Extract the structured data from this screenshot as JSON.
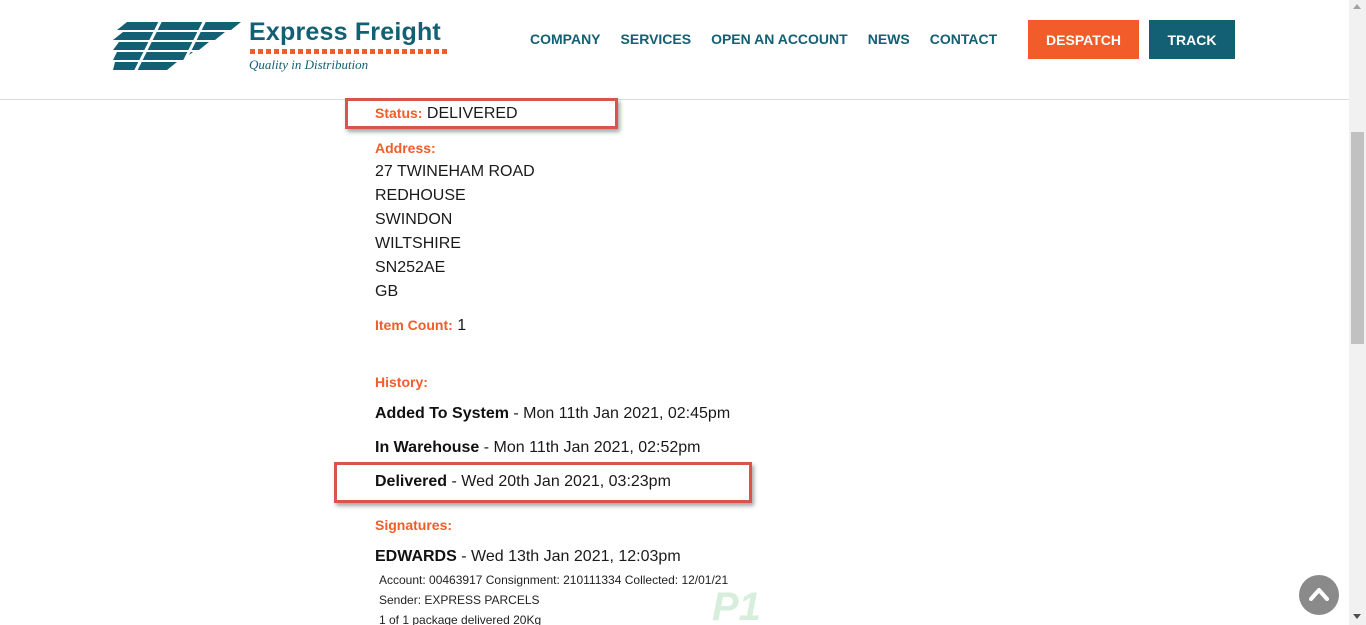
{
  "brand": {
    "name": "Express Freight",
    "tagline": "Quality in Distribution"
  },
  "nav": {
    "items": [
      "COMPANY",
      "SERVICES",
      "OPEN AN ACCOUNT",
      "NEWS",
      "CONTACT"
    ],
    "despatch": "DESPATCH",
    "track": "TRACK"
  },
  "shipment": {
    "status_label": "Status:",
    "status_value": "DELIVERED",
    "address_label": "Address:",
    "address_lines": [
      "27 TWINEHAM ROAD",
      "REDHOUSE",
      "SWINDON",
      "WILTSHIRE",
      "SN252AE",
      "GB"
    ],
    "item_count_label": "Item Count:",
    "item_count_value": "1",
    "history_label": "History:",
    "history": [
      {
        "event": "Added To System",
        "date": "- Mon 11th Jan 2021, 02:45pm"
      },
      {
        "event": "In Warehouse",
        "date": "- Mon 11th Jan 2021, 02:52pm"
      },
      {
        "event": "Delivered",
        "date": "- Wed 20th Jan 2021, 03:23pm"
      }
    ],
    "signatures_label": "Signatures:",
    "signature": {
      "name": "EDWARDS",
      "date": "- Wed 13th Jan 2021, 12:03pm",
      "line1": "Account: 00463917 Consignment: 210111334 Collected: 12/01/21",
      "line2": "Sender: EXPRESS PARCELS",
      "line3": "1 of 1 package delivered  20Kg",
      "stamp": "P1"
    }
  },
  "colors": {
    "brand_teal": "#135f73",
    "accent_orange": "#f25c2a",
    "highlight_red": "#d9534f"
  },
  "icons": {
    "back_to_top": "chevron-up-icon"
  }
}
